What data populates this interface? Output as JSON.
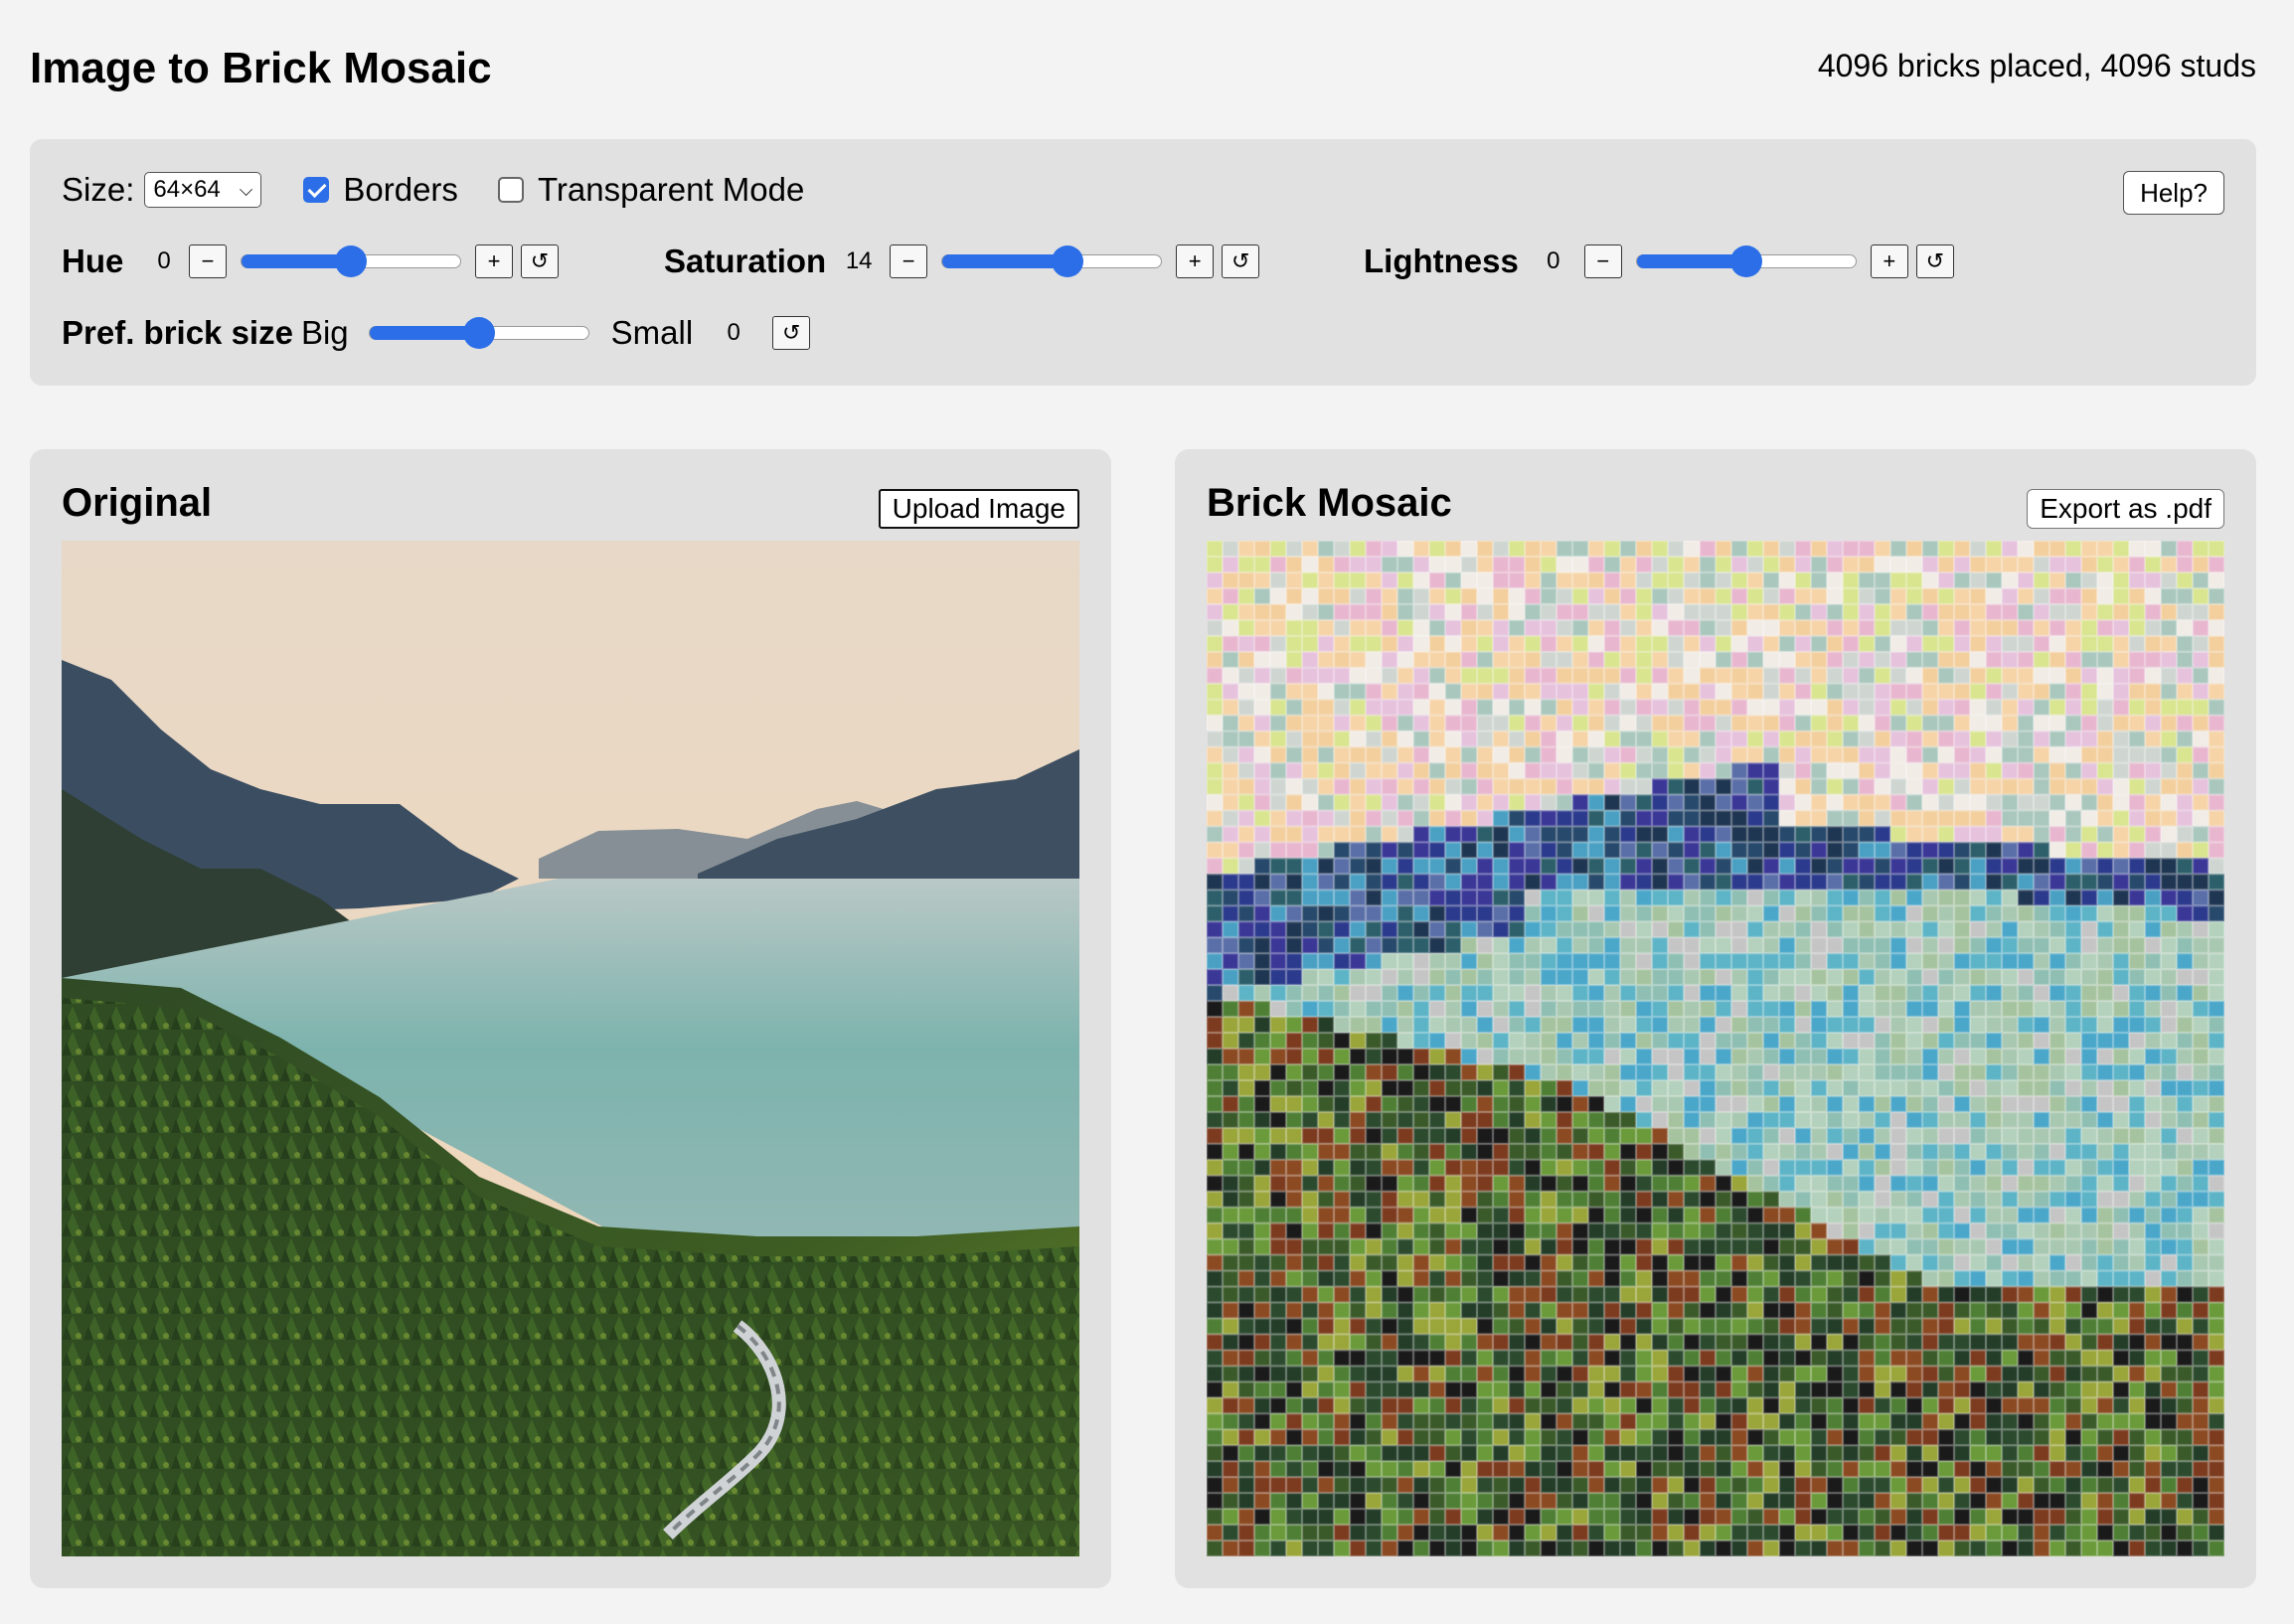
{
  "app": {
    "title": "Image to Brick Mosaic",
    "stats": "4096 bricks placed, 4096 studs"
  },
  "controls": {
    "size_label": "Size:",
    "size_value": "64×64",
    "borders_label": "Borders",
    "borders_checked": true,
    "transparent_label": "Transparent Mode",
    "transparent_checked": false,
    "help_label": "Help?",
    "hue": {
      "label": "Hue",
      "value": "0",
      "level": 0.5
    },
    "saturation": {
      "label": "Saturation",
      "value": "14",
      "level": 0.57
    },
    "lightness": {
      "label": "Lightness",
      "value": "0",
      "level": 0.5
    },
    "brick_size": {
      "label": "Pref. brick size",
      "left_label": "Big",
      "right_label": "Small",
      "value": "0",
      "level": 0.5
    },
    "minus_symbol": "−",
    "plus_symbol": "+",
    "reset_symbol": "↺"
  },
  "panels": {
    "original": {
      "title": "Original",
      "button": "Upload Image"
    },
    "mosaic": {
      "title": "Brick Mosaic",
      "button": "Export as .pdf"
    }
  },
  "colors": {
    "accent": "#2b6ee8",
    "panel_bg": "#e1e1e1",
    "page_bg": "#f3f3f3"
  },
  "mosaic": {
    "grid": 64
  }
}
